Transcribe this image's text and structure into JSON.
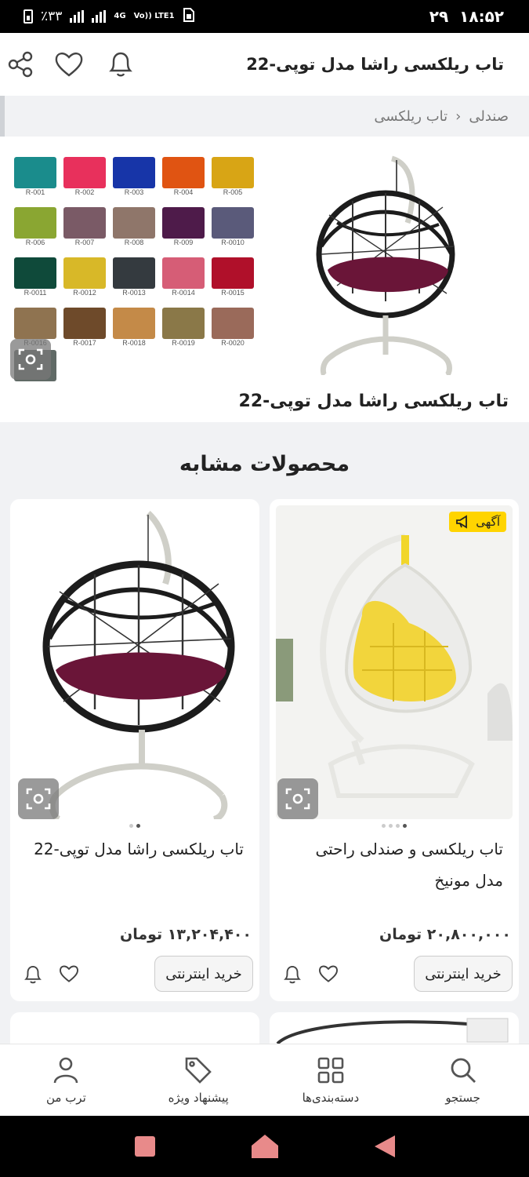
{
  "status_bar": {
    "time": "۱۸:۵۲",
    "date": "۲۹",
    "battery": "٪۳۳",
    "network": "4G",
    "volte": "Vo)) LTE1"
  },
  "app_bar": {
    "title": "تاب ریلکسی راشا مدل توپی-22"
  },
  "breadcrumb": {
    "items": [
      "صندلی",
      "تاب ریلکسی"
    ],
    "separator": "›"
  },
  "gallery": {
    "swatch_codes": [
      "R-001",
      "R-002",
      "R-003",
      "R-004",
      "R-005",
      "R-006",
      "R-007",
      "R-008",
      "R-009",
      "R-0010",
      "R-0011",
      "R-0012",
      "R-0013",
      "R-0014",
      "R-0015",
      "R-0016",
      "R-0017",
      "R-0018",
      "R-0019",
      "R-0020"
    ],
    "swatch_colors": [
      "#1a8c8c",
      "#e8305c",
      "#1735a8",
      "#e05412",
      "#d8a515",
      "#8aa632",
      "#7a5a66",
      "#8f766a",
      "#4e1b4a",
      "#5a5a7a",
      "#0f4a3a",
      "#d8b828",
      "#343a3f",
      "#d65d76",
      "#b0102a",
      "#8f7350",
      "#6e4a2a",
      "#c48a48",
      "#8a7848",
      "#9a6a5a",
      "#606a66"
    ]
  },
  "product": {
    "title": "تاب ریلکسی راشا مدل توپی-22"
  },
  "similar": {
    "heading": "محصولات مشابه",
    "items": [
      {
        "name": "تاب ریلکسی و صندلی راحتی مدل مونیخ",
        "price": "۲۰,۸۰۰,۰۰۰ تومان",
        "buy_label": "خرید اینترنتی",
        "ad_label": "آگهی",
        "image_icon": "egg-swing-chair-yellow"
      },
      {
        "name": "تاب ریلکسی راشا مدل توپی-22",
        "price": "۱۳,۲۰۴,۴۰۰ تومان",
        "buy_label": "خرید اینترنتی",
        "image_icon": "round-swing-chair-black"
      }
    ]
  },
  "bottom_nav": {
    "items": [
      "جستجو",
      "دسته‌بندی‌ها",
      "پیشنهاد ویژه",
      "ترب من"
    ]
  },
  "colors": {
    "accent_yellow": "#ffd400",
    "background": "#f1f2f4",
    "cushion": "#6a1538",
    "rattan": "#1c1c1c",
    "frame": "#dcdcd6"
  }
}
